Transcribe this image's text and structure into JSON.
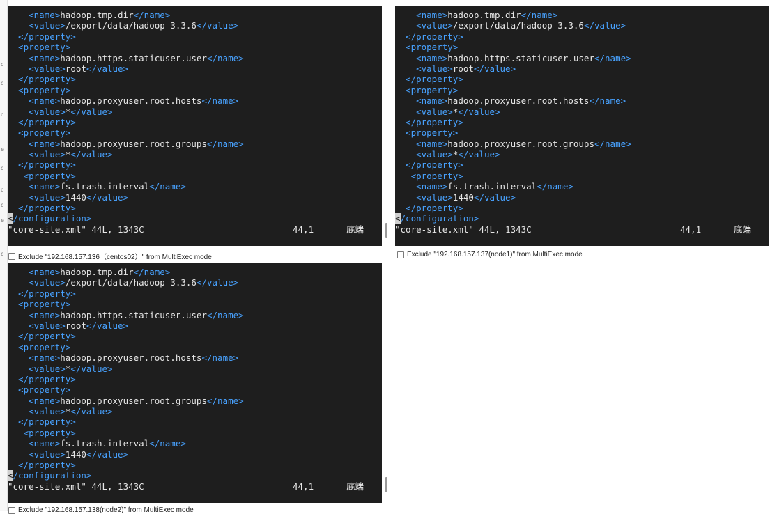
{
  "left_strip": {
    "marks": [
      "c",
      "c",
      "c",
      "e",
      "c",
      "c",
      "c",
      "e",
      "c"
    ]
  },
  "panes": [
    {
      "lines": [
        [
          {
            "c": "tag",
            "t": "    <name>"
          },
          {
            "c": "txt",
            "t": "hadoop.tmp.dir"
          },
          {
            "c": "tag",
            "t": "</name>"
          }
        ],
        [
          {
            "c": "tag",
            "t": "    <value>"
          },
          {
            "c": "txt",
            "t": "/export/data/hadoop-3.3.6"
          },
          {
            "c": "tag",
            "t": "</value>"
          }
        ],
        [
          {
            "c": "tag",
            "t": "  </property>"
          }
        ],
        [
          {
            "c": "tag",
            "t": "  <property>"
          }
        ],
        [
          {
            "c": "tag",
            "t": "    <name>"
          },
          {
            "c": "txt",
            "t": "hadoop.https.staticuser.user"
          },
          {
            "c": "tag",
            "t": "</name>"
          }
        ],
        [
          {
            "c": "tag",
            "t": "    <value>"
          },
          {
            "c": "txt",
            "t": "root"
          },
          {
            "c": "tag",
            "t": "</value>"
          }
        ],
        [
          {
            "c": "tag",
            "t": "  </property>"
          }
        ],
        [
          {
            "c": "tag",
            "t": "  <property>"
          }
        ],
        [
          {
            "c": "tag",
            "t": "    <name>"
          },
          {
            "c": "txt",
            "t": "hadoop.proxyuser.root.hosts"
          },
          {
            "c": "tag",
            "t": "</name>"
          }
        ],
        [
          {
            "c": "tag",
            "t": "    <value>"
          },
          {
            "c": "txt",
            "t": "*"
          },
          {
            "c": "tag",
            "t": "</value>"
          }
        ],
        [
          {
            "c": "tag",
            "t": "  </property>"
          }
        ],
        [
          {
            "c": "tag",
            "t": "  <property>"
          }
        ],
        [
          {
            "c": "tag",
            "t": "    <name>"
          },
          {
            "c": "txt",
            "t": "hadoop.proxyuser.root.groups"
          },
          {
            "c": "tag",
            "t": "</name>"
          }
        ],
        [
          {
            "c": "tag",
            "t": "    <value>"
          },
          {
            "c": "txt",
            "t": "*"
          },
          {
            "c": "tag",
            "t": "</value>"
          }
        ],
        [
          {
            "c": "tag",
            "t": "  </property>"
          }
        ],
        [
          {
            "c": "tag",
            "t": "   <property>"
          }
        ],
        [
          {
            "c": "tag",
            "t": "    <name>"
          },
          {
            "c": "txt",
            "t": "fs.trash.interval"
          },
          {
            "c": "tag",
            "t": "</name>"
          }
        ],
        [
          {
            "c": "tag",
            "t": "    <value>"
          },
          {
            "c": "txt",
            "t": "1440"
          },
          {
            "c": "tag",
            "t": "</value>"
          }
        ],
        [
          {
            "c": "tag",
            "t": "  </property>"
          }
        ],
        [
          {
            "c": "cursor",
            "t": "<"
          },
          {
            "c": "tag",
            "t": "/configuration>"
          }
        ]
      ],
      "status": {
        "file": "\"core-site.xml\" 44L, 1343C",
        "position": "44,1",
        "where": "底端"
      },
      "exclude": "Exclude \"192.168.157.136（centos02）\" from MultiExec mode"
    },
    {
      "lines": [
        [
          {
            "c": "tag",
            "t": "    <name>"
          },
          {
            "c": "txt",
            "t": "hadoop.tmp.dir"
          },
          {
            "c": "tag",
            "t": "</name>"
          }
        ],
        [
          {
            "c": "tag",
            "t": "    <value>"
          },
          {
            "c": "txt",
            "t": "/export/data/hadoop-3.3.6"
          },
          {
            "c": "tag",
            "t": "</value>"
          }
        ],
        [
          {
            "c": "tag",
            "t": "  </property>"
          }
        ],
        [
          {
            "c": "tag",
            "t": "  <property>"
          }
        ],
        [
          {
            "c": "tag",
            "t": "    <name>"
          },
          {
            "c": "txt",
            "t": "hadoop.https.staticuser.user"
          },
          {
            "c": "tag",
            "t": "</name>"
          }
        ],
        [
          {
            "c": "tag",
            "t": "    <value>"
          },
          {
            "c": "txt",
            "t": "root"
          },
          {
            "c": "tag",
            "t": "</value>"
          }
        ],
        [
          {
            "c": "tag",
            "t": "  </property>"
          }
        ],
        [
          {
            "c": "tag",
            "t": "  <property>"
          }
        ],
        [
          {
            "c": "tag",
            "t": "    <name>"
          },
          {
            "c": "txt",
            "t": "hadoop.proxyuser.root.hosts"
          },
          {
            "c": "tag",
            "t": "</name>"
          }
        ],
        [
          {
            "c": "tag",
            "t": "    <value>"
          },
          {
            "c": "txt",
            "t": "*"
          },
          {
            "c": "tag",
            "t": "</value>"
          }
        ],
        [
          {
            "c": "tag",
            "t": "  </property>"
          }
        ],
        [
          {
            "c": "tag",
            "t": "  <property>"
          }
        ],
        [
          {
            "c": "tag",
            "t": "    <name>"
          },
          {
            "c": "txt",
            "t": "hadoop.proxyuser.root.groups"
          },
          {
            "c": "tag",
            "t": "</name>"
          }
        ],
        [
          {
            "c": "tag",
            "t": "    <value>"
          },
          {
            "c": "txt",
            "t": "*"
          },
          {
            "c": "tag",
            "t": "</value>"
          }
        ],
        [
          {
            "c": "tag",
            "t": "  </property>"
          }
        ],
        [
          {
            "c": "tag",
            "t": "   <property>"
          }
        ],
        [
          {
            "c": "tag",
            "t": "    <name>"
          },
          {
            "c": "txt",
            "t": "fs.trash.interval"
          },
          {
            "c": "tag",
            "t": "</name>"
          }
        ],
        [
          {
            "c": "tag",
            "t": "    <value>"
          },
          {
            "c": "txt",
            "t": "1440"
          },
          {
            "c": "tag",
            "t": "</value>"
          }
        ],
        [
          {
            "c": "tag",
            "t": "  </property>"
          }
        ],
        [
          {
            "c": "cursor",
            "t": "<"
          },
          {
            "c": "tag",
            "t": "/configuration>"
          }
        ]
      ],
      "status": {
        "file": "\"core-site.xml\" 44L, 1343C",
        "position": "44,1",
        "where": "底端"
      },
      "exclude": "Exclude \"192.168.157.137(node1)\" from MultiExec mode"
    },
    {
      "lines": [
        [
          {
            "c": "tag",
            "t": "    <name>"
          },
          {
            "c": "txt",
            "t": "hadoop.tmp.dir"
          },
          {
            "c": "tag",
            "t": "</name>"
          }
        ],
        [
          {
            "c": "tag",
            "t": "    <value>"
          },
          {
            "c": "txt",
            "t": "/export/data/hadoop-3.3.6"
          },
          {
            "c": "tag",
            "t": "</value>"
          }
        ],
        [
          {
            "c": "tag",
            "t": "  </property>"
          }
        ],
        [
          {
            "c": "tag",
            "t": "  <property>"
          }
        ],
        [
          {
            "c": "tag",
            "t": "    <name>"
          },
          {
            "c": "txt",
            "t": "hadoop.https.staticuser.user"
          },
          {
            "c": "tag",
            "t": "</name>"
          }
        ],
        [
          {
            "c": "tag",
            "t": "    <value>"
          },
          {
            "c": "txt",
            "t": "root"
          },
          {
            "c": "tag",
            "t": "</value>"
          }
        ],
        [
          {
            "c": "tag",
            "t": "  </property>"
          }
        ],
        [
          {
            "c": "tag",
            "t": "  <property>"
          }
        ],
        [
          {
            "c": "tag",
            "t": "    <name>"
          },
          {
            "c": "txt",
            "t": "hadoop.proxyuser.root.hosts"
          },
          {
            "c": "tag",
            "t": "</name>"
          }
        ],
        [
          {
            "c": "tag",
            "t": "    <value>"
          },
          {
            "c": "txt",
            "t": "*"
          },
          {
            "c": "tag",
            "t": "</value>"
          }
        ],
        [
          {
            "c": "tag",
            "t": "  </property>"
          }
        ],
        [
          {
            "c": "tag",
            "t": "  <property>"
          }
        ],
        [
          {
            "c": "tag",
            "t": "    <name>"
          },
          {
            "c": "txt",
            "t": "hadoop.proxyuser.root.groups"
          },
          {
            "c": "tag",
            "t": "</name>"
          }
        ],
        [
          {
            "c": "tag",
            "t": "    <value>"
          },
          {
            "c": "txt",
            "t": "*"
          },
          {
            "c": "tag",
            "t": "</value>"
          }
        ],
        [
          {
            "c": "tag",
            "t": "  </property>"
          }
        ],
        [
          {
            "c": "tag",
            "t": "   <property>"
          }
        ],
        [
          {
            "c": "tag",
            "t": "    <name>"
          },
          {
            "c": "txt",
            "t": "fs.trash.interval"
          },
          {
            "c": "tag",
            "t": "</name>"
          }
        ],
        [
          {
            "c": "tag",
            "t": "    <value>"
          },
          {
            "c": "txt",
            "t": "1440"
          },
          {
            "c": "tag",
            "t": "</value>"
          }
        ],
        [
          {
            "c": "tag",
            "t": "  </property>"
          }
        ],
        [
          {
            "c": "cursor",
            "t": "<"
          },
          {
            "c": "tag",
            "t": "/configuration>"
          }
        ]
      ],
      "status": {
        "file": "\"core-site.xml\" 44L, 1343C",
        "position": "44,1",
        "where": "底端"
      },
      "exclude": "Exclude \"192.168.157.138(node2)\" from MultiExec mode"
    }
  ],
  "colors": {
    "terminal_bg": "#1e1e1e",
    "xml_tag": "#48a2ff",
    "text": "#e6e6e6"
  }
}
